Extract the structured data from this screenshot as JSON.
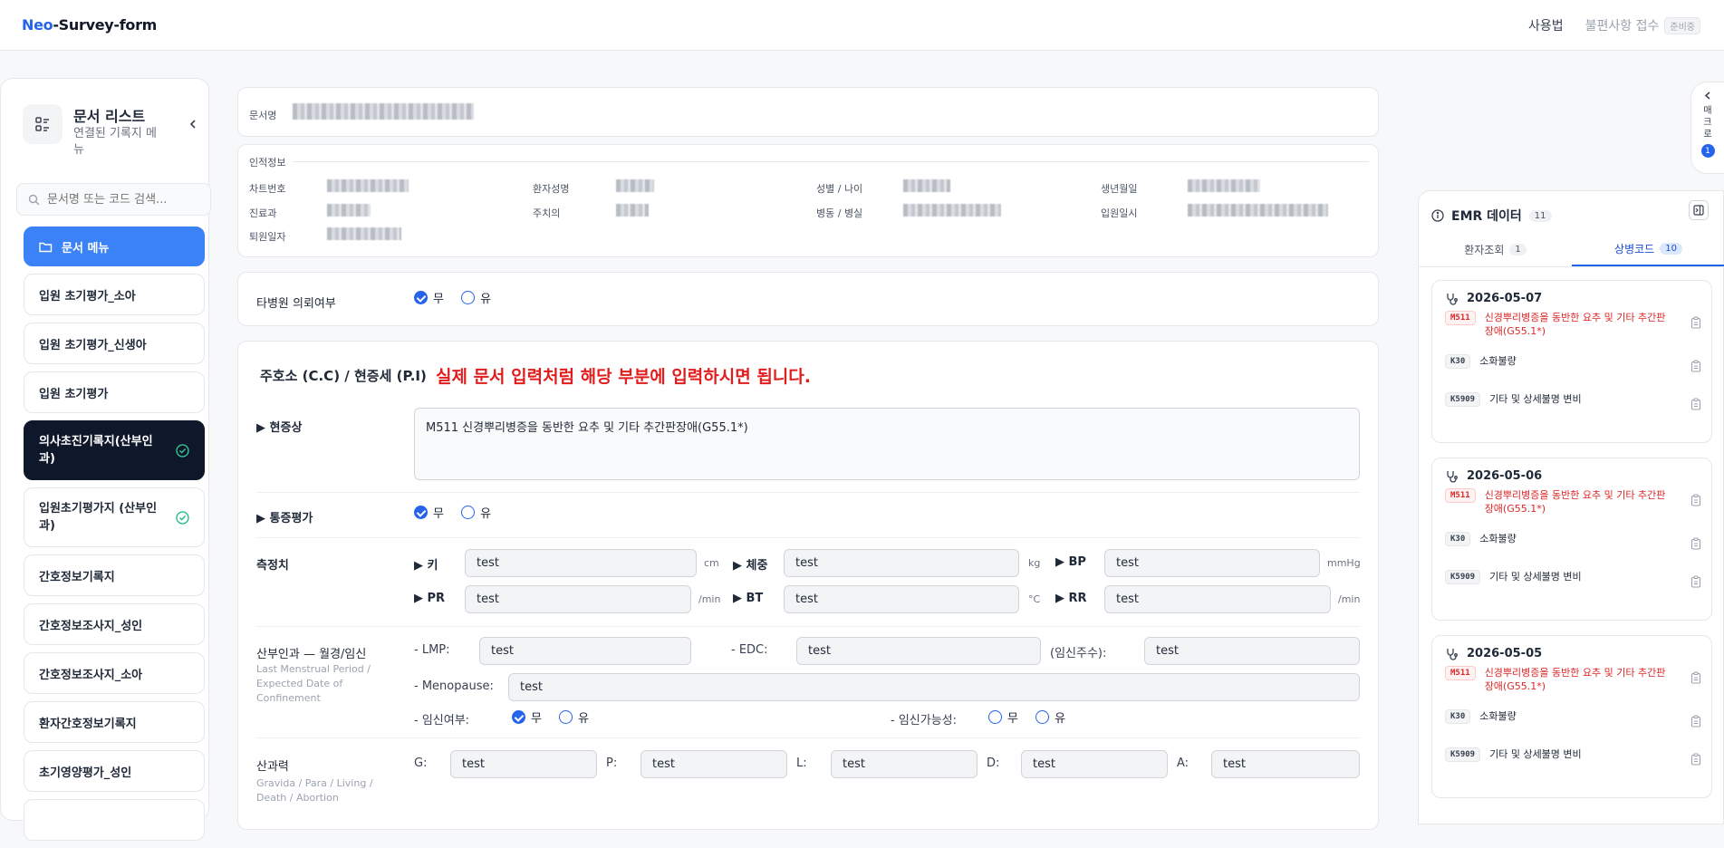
{
  "app": {
    "logo_prefix": "Neo",
    "logo_suffix": "-Survey-form"
  },
  "topnav": {
    "usage": "사용법",
    "report": "불편사항 접수",
    "prep_badge": "준비중"
  },
  "sidebar": {
    "title": "문서 리스트",
    "subtitle": "연결된 기록지 메뉴",
    "search_placeholder": "문서명 또는 코드 검색...",
    "items": [
      {
        "label": "문서 메뉴",
        "style": "primary"
      },
      {
        "label": "입원 초기평가_소아"
      },
      {
        "label": "입원 초기평가_신생아"
      },
      {
        "label": "입원 초기평가"
      },
      {
        "label": "의사초진기록지(산부인과)",
        "style": "dark",
        "checked": true
      },
      {
        "label": "입원초기평가지 (산부인과)",
        "checked": true
      },
      {
        "label": "간호정보기록지"
      },
      {
        "label": "간호정보조사지_성인"
      },
      {
        "label": "간호정보조사지_소아"
      },
      {
        "label": "환자간호정보기록지"
      },
      {
        "label": "초기영양평가_성인"
      }
    ]
  },
  "doc": {
    "name_label": "문서명"
  },
  "personal": {
    "title": "인적정보",
    "fields": {
      "chart_no": "차트번호",
      "patient_name": "환자성명",
      "sex_age": "성별 / 나이",
      "birth": "생년월일",
      "dept": "진료과",
      "doctor": "주치의",
      "ward_room": "병동 / 병실",
      "admit_date": "입원일시",
      "discharge_date": "퇴원일자"
    }
  },
  "transfer": {
    "label": "타병원 의뢰여부",
    "no": "무",
    "yes": "유",
    "selected": "no"
  },
  "main": {
    "section_title": "주호소 (C.C) / 현증세 (P.I)",
    "notice": "실제 문서 입력처럼 해당 부분에 입력하시면 됩니다.",
    "symptom_label": "▶ 현증상",
    "symptom_value": "M511 신경뿌리병증을 동반한 요추 및 기타 추간판장애(G55.1*)",
    "pain_label": "▶ 통증평가",
    "pain_no": "무",
    "pain_yes": "유",
    "vitals": {
      "label": "측정치",
      "height_label": "▶ 키",
      "height_value": "test",
      "height_unit": "cm",
      "weight_label": "▶ 체중",
      "weight_value": "test",
      "weight_unit": "kg",
      "bp_label": "▶ BP",
      "bp_value": "test",
      "bp_unit": "mmHg",
      "pr_label": "▶ PR",
      "pr_value": "test",
      "pr_unit": "/min",
      "bt_label": "▶ BT",
      "bt_value": "test",
      "bt_unit": "°C",
      "rr_label": "▶ RR",
      "rr_value": "test",
      "rr_unit": "/min"
    },
    "ob": {
      "label": "산부인과 — 월경/임신",
      "sub": "Last Menstrual Period / Expected Date of Confinement",
      "lmp_label": "- LMP:",
      "lmp_value": "test",
      "edc_label": "- EDC:",
      "edc_value": "test",
      "ga_label": "(임신주수):",
      "ga_value": "test",
      "menopause_label": "- Menopause:",
      "menopause_value": "test",
      "pregnant_label": "- 임신여부:",
      "preg_no": "무",
      "preg_yes": "유",
      "possible_label": "- 임신가능성:",
      "poss_no": "무",
      "poss_yes": "유"
    },
    "obhx": {
      "label": "산과력",
      "sub": "Gravida / Para / Living / Death / Abortion",
      "g_label": "G:",
      "g_value": "test",
      "p_label": "P:",
      "p_value": "test",
      "l_label": "L:",
      "l_value": "test",
      "d_label": "D:",
      "d_value": "test",
      "a_label": "A:",
      "a_value": "test"
    }
  },
  "macro": {
    "label": "매크로",
    "count": "1"
  },
  "emr": {
    "title": "EMR 데이터",
    "count": "11",
    "tab1": "환자조회",
    "tab1_count": "1",
    "tab2": "상병코드",
    "tab2_count": "10",
    "days": [
      {
        "date": "2026-05-07",
        "codes": [
          {
            "code": "M511",
            "desc": "신경뿌리병증을 동반한 요추 및 기타 추간판장애(G55.1*)",
            "highlight": true
          },
          {
            "code": "K30",
            "desc": "소화불량"
          },
          {
            "code": "K5909",
            "desc": "기타 및 상세불명 변비"
          }
        ]
      },
      {
        "date": "2026-05-06",
        "codes": [
          {
            "code": "M511",
            "desc": "신경뿌리병증을 동반한 요추 및 기타 추간판장애(G55.1*)",
            "highlight": true
          },
          {
            "code": "K30",
            "desc": "소화불량"
          },
          {
            "code": "K5909",
            "desc": "기타 및 상세불명 변비"
          }
        ]
      },
      {
        "date": "2026-05-05",
        "codes": [
          {
            "code": "M511",
            "desc": "신경뿌리병증을 동반한 요추 및 기타 추간판장애(G55.1*)",
            "highlight": true
          },
          {
            "code": "K30",
            "desc": "소화불량"
          },
          {
            "code": "K5909",
            "desc": "기타 및 상세불명 변비"
          }
        ]
      }
    ]
  }
}
